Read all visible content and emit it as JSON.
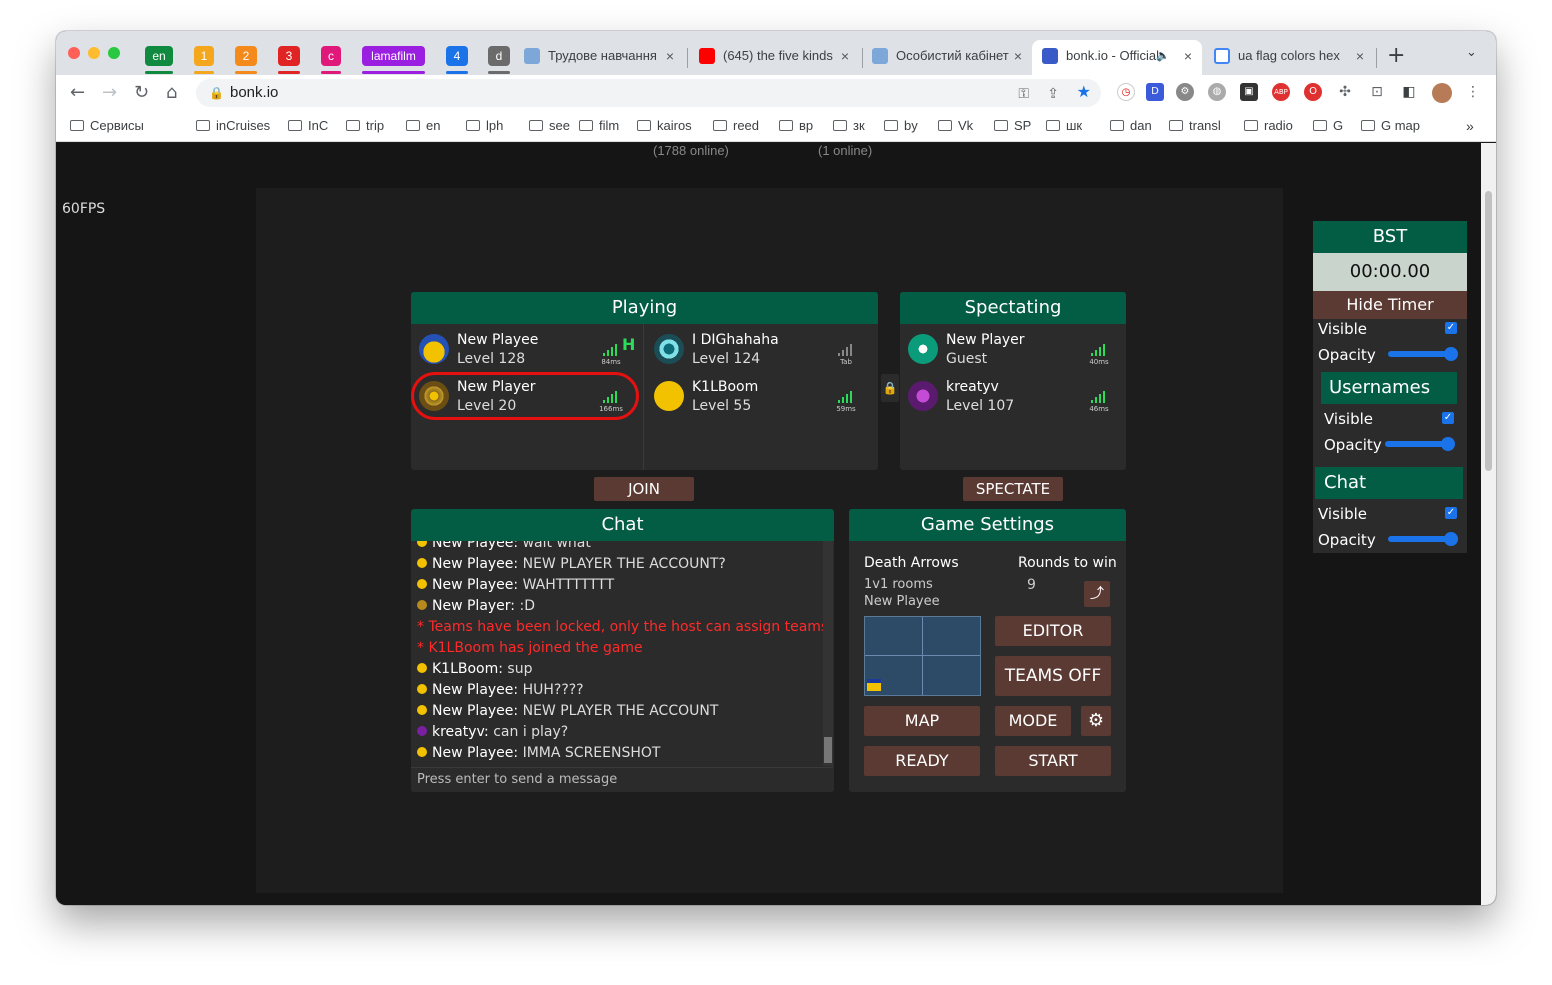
{
  "browser": {
    "pinned_tabs": [
      {
        "label": "en",
        "color": "#0f8a3e"
      },
      {
        "label": "1",
        "color": "#f4a61c"
      },
      {
        "label": "2",
        "color": "#f48a1c"
      },
      {
        "label": "3",
        "color": "#e02424"
      },
      {
        "label": "c",
        "color": "#e0187a"
      },
      {
        "label": "lamafilm",
        "color": "#9b1fe0"
      },
      {
        "label": "4",
        "color": "#1a73e8"
      },
      {
        "label": "d",
        "color": "#6b6b6b"
      }
    ],
    "tabs": [
      {
        "title": "Трудове навчання",
        "icon": "globe-icon"
      },
      {
        "title": "(645) the five kinds",
        "icon": "youtube-icon"
      },
      {
        "title": "Особистий кабінет",
        "icon": "globe-icon"
      },
      {
        "title": "bonk.io - Official",
        "icon": "bonk-icon",
        "active": true
      },
      {
        "title": "ua flag colors hex",
        "icon": "google-icon"
      }
    ],
    "new_tab": "+",
    "url": "bonk.io",
    "bookmarks": [
      "Сервисы",
      "inCruises",
      "InC",
      "trip",
      "en",
      "lph",
      "see",
      "film",
      "kairos",
      "reed",
      "вр",
      "зк",
      "by",
      "Vk",
      "SP",
      "шк",
      "dan",
      "transl",
      "radio",
      "G",
      "G map"
    ],
    "bookmarks_more": "»"
  },
  "game": {
    "online_left": "(1788 online)",
    "online_right": "(1 online)",
    "fps": "60FPS",
    "playing": {
      "title": "Playing",
      "players": [
        {
          "name": "New Playee",
          "level": "Level 128",
          "ping": "84ms",
          "host": "H"
        },
        {
          "name": "I DIGhahaha",
          "level": "Level 124",
          "ping": "Tab"
        },
        {
          "name": "New Player",
          "level": "Level 20",
          "ping": "166ms"
        },
        {
          "name": "K1LBoom",
          "level": "Level 55",
          "ping": "59ms"
        }
      ]
    },
    "spectating": {
      "title": "Spectating",
      "players": [
        {
          "name": "New Player",
          "level": "Guest",
          "ping": "40ms"
        },
        {
          "name": "kreatyv",
          "level": "Level 107",
          "ping": "46ms"
        }
      ]
    },
    "join_label": "JOIN",
    "spectate_label": "SPECTATE",
    "chat": {
      "title": "Chat",
      "lines": [
        {
          "user": "New Playee:",
          "text": " wait what",
          "dot": "#f2c100"
        },
        {
          "user": "New Playee:",
          "text": " NEW PLAYER THE ACCOUNT?",
          "dot": "#f2c100"
        },
        {
          "user": "New Playee:",
          "text": " WAHTTTTTTT",
          "dot": "#f2c100"
        },
        {
          "user": "New Player:",
          "text": " :D",
          "dot": "#b88a1e"
        },
        {
          "sys": "* Teams have been locked, only the host can assign teams"
        },
        {
          "sys": "* K1LBoom has joined the game"
        },
        {
          "user": "K1LBoom:",
          "text": " sup",
          "dot": "#f2c100"
        },
        {
          "user": "New Playee:",
          "text": " HUH????",
          "dot": "#f2c100"
        },
        {
          "user": "New Playee:",
          "text": " NEW PLAYER THE ACCOUNT",
          "dot": "#f2c100"
        },
        {
          "user": "kreatyv:",
          "text": " can i play?",
          "dot": "#7b1fa2"
        },
        {
          "user": "New Playee:",
          "text": " IMMA SCREENSHOT",
          "dot": "#f2c100"
        }
      ],
      "input_placeholder": "Press enter to send a message"
    },
    "settings": {
      "title": "Game Settings",
      "mode_name": "Death Arrows",
      "room_type": "1v1 rooms",
      "author": "New Playee",
      "rounds_label": "Rounds to win",
      "rounds_value": "9",
      "editor": "EDITOR",
      "teams": "TEAMS OFF",
      "map": "MAP",
      "mode": "MODE",
      "ready": "READY",
      "start": "START"
    }
  },
  "sidebar": {
    "timer_title": "BST",
    "timer_value": "00:00.00",
    "hide_timer": "Hide Timer",
    "visible": "Visible",
    "opacity": "Opacity",
    "usernames_title": "Usernames",
    "chat_title": "Chat"
  },
  "colors": {
    "accent_green": "#025d44",
    "button_brown": "#5a3a33",
    "system_red": "#ff2a2a",
    "ping_green": "#2bdc5a"
  }
}
